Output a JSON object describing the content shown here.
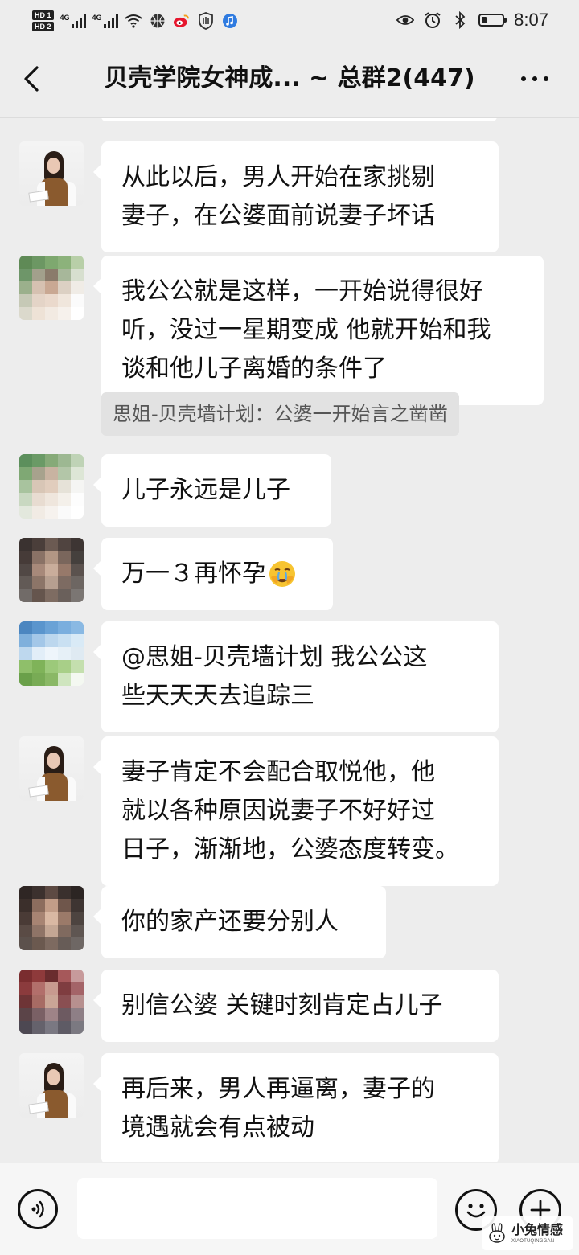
{
  "status_bar": {
    "sim1": "HD 1",
    "sim2": "HD 2",
    "net1": "4G",
    "net2": "4G",
    "time": "8:07",
    "battery_level": 0.25,
    "icons": [
      "wifi-icon",
      "basketball-icon",
      "weibo-icon",
      "shield-hand-icon",
      "music-icon",
      "eye-icon",
      "alarm-icon",
      "bluetooth-icon",
      "battery-icon"
    ]
  },
  "header": {
    "title": "贝壳学院女神成... ~ 总群2(447)",
    "back_icon": "chevron-left-icon",
    "more_icon": "more-icon"
  },
  "messages": [
    {
      "avatar": "woman-portrait",
      "lines": [
        "从此以后，男人开始在家挑剔",
        "妻子，在公婆面前说妻子坏话"
      ]
    },
    {
      "avatar": "mosaic-green",
      "lines": [
        "我公公就是这样，一开始说得很好",
        "听，没过一星期变成 他就开始和我",
        "谈和他儿子离婚的条件了"
      ],
      "quote": "思姐-贝壳墙计划：公婆一开始言之凿凿"
    },
    {
      "avatar": "mosaic-green-2",
      "lines": [
        "儿子永远是儿子"
      ]
    },
    {
      "avatar": "mosaic-dark",
      "lines": [
        "万一３再怀孕"
      ],
      "emoji": "crying-face"
    },
    {
      "avatar": "mosaic-sky",
      "lines": [
        "@思姐-贝壳墙计划  我公公这",
        "些天天天去追踪三"
      ]
    },
    {
      "avatar": "woman-portrait",
      "lines": [
        "妻子肯定不会配合取悦他，他",
        "就以各种原因说妻子不好好过",
        "日子，渐渐地，公婆态度转变。"
      ]
    },
    {
      "avatar": "mosaic-dark-2",
      "lines": [
        "你的家产还要分别人"
      ]
    },
    {
      "avatar": "mosaic-red",
      "lines": [
        "别信公婆 关键时刻肯定占儿子"
      ]
    },
    {
      "avatar": "woman-portrait",
      "lines": [
        "再后来，男人再逼离，妻子的",
        "境遇就会有点被动"
      ]
    }
  ],
  "input_bar": {
    "placeholder": "",
    "voice_icon": "voice-icon",
    "emoji_icon": "emoji-icon",
    "plus_icon": "plus-icon"
  },
  "watermark": {
    "text": "小兔情感",
    "sub": "XIAOTUQINGGAN"
  }
}
